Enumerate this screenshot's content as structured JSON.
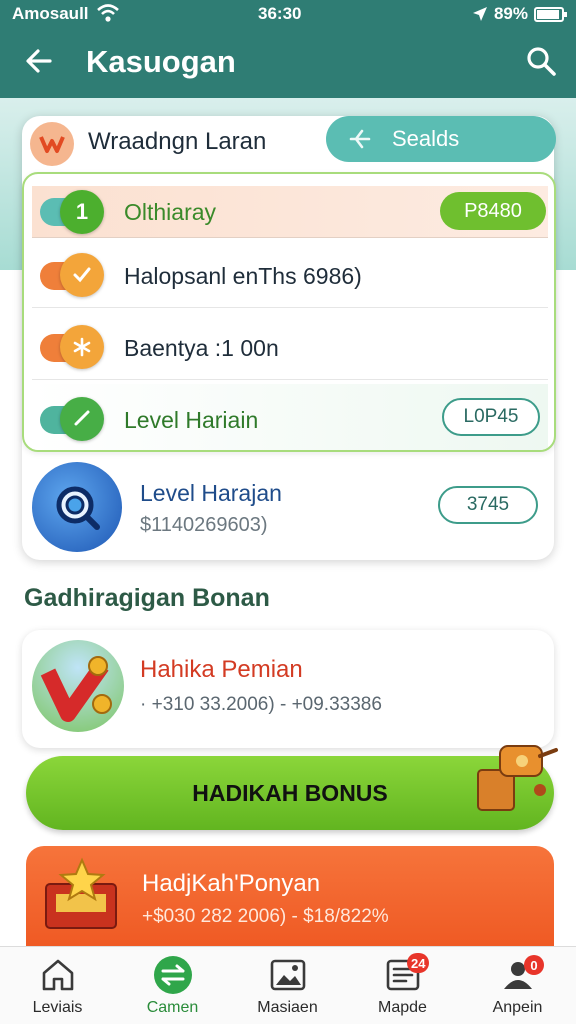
{
  "status_bar": {
    "carrier": "Amosaull",
    "time": "36:30",
    "battery": "89%"
  },
  "header": {
    "title": "Kasuogan"
  },
  "card": {
    "title": "Wraadngn Laran",
    "seals_label": "Sealds",
    "rows": [
      {
        "badge": "1",
        "label": "Olthiaray",
        "value": "P8480"
      },
      {
        "label": "Halopsanl enThs 6986)"
      },
      {
        "label": "Baentya :1 00n"
      },
      {
        "label": "Level Hariain",
        "value": "L0P45"
      }
    ],
    "level": {
      "title": "Level Harajan",
      "subtitle": "$1140269603)",
      "value": "3745"
    }
  },
  "section": {
    "title": "Gadhiragigan Bonan"
  },
  "bonus": {
    "title": "Hahika Pemian",
    "subtitle": "· +310 33.2006) - +09.33386"
  },
  "cta": {
    "label": "HADIKAH BONUS"
  },
  "promo": {
    "title": "HadjKah'Ponyan",
    "subtitle": "+$030 282 2006) - $18/822%"
  },
  "nav": [
    {
      "label": "Leviais",
      "icon": "home-icon",
      "active": false
    },
    {
      "label": "Camen",
      "icon": "exchange-icon",
      "active": true
    },
    {
      "label": "Masiaen",
      "icon": "gallery-icon",
      "active": false
    },
    {
      "label": "Mapde",
      "icon": "list-icon",
      "active": false,
      "badge": "24"
    },
    {
      "label": "Anpein",
      "icon": "profile-icon",
      "active": false,
      "badge": "0"
    }
  ],
  "colors": {
    "primary": "#2f7d74",
    "accent_green": "#6fbf2f",
    "accent_orange": "#ef5a24",
    "danger": "#e8352a"
  }
}
